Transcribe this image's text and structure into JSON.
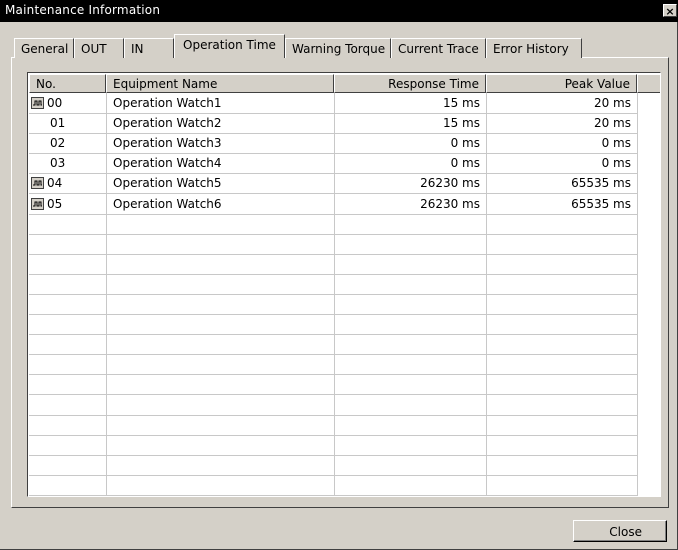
{
  "window": {
    "title": "Maintenance Information",
    "close_glyph": "×"
  },
  "tabs": [
    {
      "label": "General",
      "active": false
    },
    {
      "label": "OUT",
      "active": false
    },
    {
      "label": "IN",
      "active": false
    },
    {
      "label": "Operation Time",
      "active": true
    },
    {
      "label": "Warning Torque",
      "active": false
    },
    {
      "label": "Current Trace",
      "active": false
    },
    {
      "label": "Error History",
      "active": false
    }
  ],
  "table": {
    "columns": [
      "No.",
      "Equipment Name",
      "Response Time",
      "Peak Value"
    ],
    "rows": [
      {
        "icon": "waveform-icon",
        "no": "00",
        "name": "Operation Watch1",
        "response": "15 ms",
        "peak": "20 ms"
      },
      {
        "icon": "",
        "no": "01",
        "name": "Operation Watch2",
        "response": "15 ms",
        "peak": "20 ms"
      },
      {
        "icon": "",
        "no": "02",
        "name": "Operation Watch3",
        "response": "0 ms",
        "peak": "0 ms"
      },
      {
        "icon": "",
        "no": "03",
        "name": "Operation Watch4",
        "response": "0 ms",
        "peak": "0 ms"
      },
      {
        "icon": "waveform-icon",
        "no": "04",
        "name": "Operation Watch5",
        "response": "26230 ms",
        "peak": "65535 ms"
      },
      {
        "icon": "waveform-icon",
        "no": "05",
        "name": "Operation Watch6",
        "response": "26230 ms",
        "peak": "65535 ms"
      }
    ]
  },
  "buttons": {
    "close_label": "Close"
  }
}
